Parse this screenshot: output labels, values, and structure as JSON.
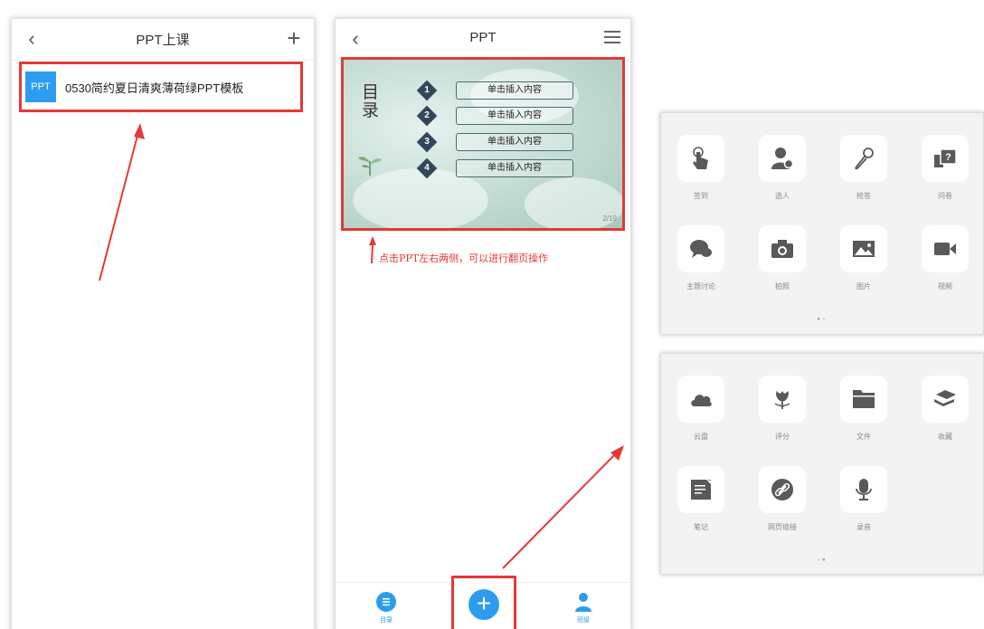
{
  "screen1": {
    "title": "PPT上课",
    "file": {
      "badge": "PPT",
      "name": "0530简约夏日清爽薄荷绿PPT模板"
    }
  },
  "screen2": {
    "title": "PPT",
    "slide": {
      "heading": "目录",
      "items": [
        {
          "num": "1",
          "label": "单击插入内容"
        },
        {
          "num": "2",
          "label": "单击插入内容"
        },
        {
          "num": "3",
          "label": "单击插入内容"
        },
        {
          "num": "4",
          "label": "单击插入内容"
        }
      ],
      "page": "2/19"
    },
    "hint": "点击PPT左右两侧，可以进行翻页操作",
    "tabs": {
      "left": "目录",
      "right": "班级"
    }
  },
  "panel1": {
    "tools": [
      "签到",
      "选人",
      "抢答",
      "问卷",
      "主题讨论",
      "拍照",
      "图片",
      "视频"
    ],
    "icons": [
      "hand-tap-icon",
      "person-icon",
      "microphone-icon",
      "questionnaire-icon",
      "chat-bubble-icon",
      "camera-icon",
      "image-icon",
      "video-icon"
    ]
  },
  "panel2": {
    "tools": [
      "云盘",
      "评分",
      "文件",
      "收藏",
      "笔记",
      "网页链接",
      "录音"
    ],
    "icons": [
      "cloud-icon",
      "flower-icon",
      "folder-icon",
      "bookmark-icon",
      "note-icon",
      "link-icon",
      "microphone-icon"
    ]
  },
  "colors": {
    "accent": "#2d9cf0",
    "annotation": "#e53935",
    "icon": "#595959"
  }
}
